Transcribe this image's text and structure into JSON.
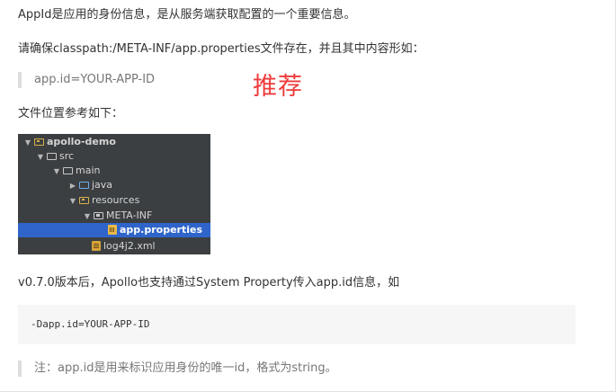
{
  "para1": "AppId是应用的身份信息，是从服务端获取配置的一个重要信息。",
  "para2": "请确保classpath:/META-INF/app.properties文件存在，并且其中内容形如：",
  "quote1": "app.id=YOUR-APP-ID",
  "annotation": "推荐",
  "para3": "文件位置参考如下：",
  "tree": {
    "root": "apollo-demo",
    "src": "src",
    "main": "main",
    "java": "java",
    "resources": "resources",
    "meta_inf": "META-INF",
    "app_properties": "app.properties",
    "log4j2": "log4j2.xml"
  },
  "para4": "v0.7.0版本后，Apollo也支持通过System Property传入app.id信息，如",
  "code": "-Dapp.id=YOUR-APP-ID",
  "note": "注：app.id是用来标识应用身份的唯一id，格式为string。",
  "colors": {
    "annotation": "#ee3b3b",
    "tree_bg": "#3c3f41",
    "tree_selected": "#2f65ca",
    "code_bg": "#f6f6f6",
    "quote_bar": "#dddddd"
  }
}
